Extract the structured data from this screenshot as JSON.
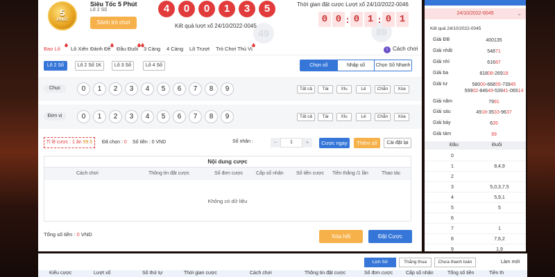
{
  "game": {
    "logo_number": "5",
    "logo_text": "PHÚT",
    "title": "Siêu Tốc 5 Phút",
    "subtitle": "Lô 2 Số",
    "lobby_button": "Sảnh trò chơi",
    "balls": [
      "4",
      "0",
      "0",
      "1",
      "3",
      "5"
    ],
    "result_text": "Kết quả lượt xổ 24/10/2022-0045",
    "countdown_label": "Thời gian đặt cược Lượt xổ 24/10/2022-0046",
    "countdown": [
      "0",
      "0",
      "0",
      "1",
      "0",
      "1"
    ],
    "watermark_balls": [
      "49",
      "89"
    ]
  },
  "tabs": [
    {
      "label": "Bao Lô",
      "active": true,
      "hot": true
    },
    {
      "label": "Lô Xiên",
      "active": false,
      "hot": false
    },
    {
      "label": "Đánh Đề",
      "active": false,
      "hot": true
    },
    {
      "label": "Đầu Đuôi",
      "active": false,
      "hot": true
    },
    {
      "label": "3 Càng",
      "active": false,
      "hot": true
    },
    {
      "label": "4 Càng",
      "active": false,
      "hot": false
    },
    {
      "label": "Lô Trượt",
      "active": false,
      "hot": false
    },
    {
      "label": "Trò Chơi Thú Vị",
      "active": false,
      "hot": true
    }
  ],
  "help_label": "Cách chơi",
  "help_icon": "i",
  "bet_types": [
    {
      "label": "Lô 2 Số",
      "active": true
    },
    {
      "label": "Lô 2 Số 1K",
      "active": false
    },
    {
      "label": "Lô 3 Số",
      "active": false
    },
    {
      "label": "Lô 4 Số",
      "active": false
    }
  ],
  "modes": [
    {
      "label": "Chọn số",
      "active": true
    },
    {
      "label": "Nhập số",
      "active": false
    },
    {
      "label": "Chọn Số Nhanh",
      "active": false
    }
  ],
  "rows": [
    {
      "label": "Chục"
    },
    {
      "label": "Đơn vị"
    }
  ],
  "digits": [
    "0",
    "1",
    "2",
    "3",
    "4",
    "5",
    "6",
    "7",
    "8",
    "9"
  ],
  "quick_select": [
    "Tất cả",
    "Tài",
    "Xỉu",
    "Lẻ",
    "Chẵn",
    "Xóa"
  ],
  "odds": {
    "label": "Tỉ lệ cược : 1 ăn",
    "value": "99.5"
  },
  "selected": {
    "label": "Đã chọn :",
    "value": "0"
  },
  "amount": {
    "label": "Số tiền :",
    "value": "0 VND"
  },
  "multiplier": {
    "label": "Số nhân :",
    "value": "1",
    "minus": "−",
    "plus": "+"
  },
  "buttons": {
    "quick_bet": "Cược ngay",
    "add_number": "Thêm số",
    "reset": "Cài đặt lại",
    "clear_all": "Xóa hết",
    "place_bet": "Đặt Cược"
  },
  "bet_table": {
    "title": "Nội dung cược",
    "headers": [
      "Cách chơi",
      "Thông tin đặt cược",
      "Số đơn cược",
      "Cấp số nhân",
      "Số tiền cược",
      "Tiền thắng /1 lần",
      "Thao tác"
    ],
    "empty": "Không có dữ liệu"
  },
  "total": {
    "label": "Tổng số tiền :",
    "value": "0",
    "unit": "VND"
  },
  "results_panel": {
    "draw_date": "24/10/2022-0045",
    "chevron": "⌄",
    "kq_label": "Kết quả 24/10/2022-0045",
    "prizes": [
      {
        "name": "Giải ĐB",
        "parts": [
          [
            "400135",
            false
          ]
        ]
      },
      {
        "name": "Giải nhất",
        "parts": [
          [
            "548",
            false
          ],
          [
            "71",
            true
          ]
        ]
      },
      {
        "name": "Giải nhì",
        "parts": [
          [
            "616",
            false
          ],
          [
            "87",
            true
          ]
        ]
      },
      {
        "name": "Giải ba",
        "parts": [
          [
            "818",
            false
          ],
          [
            "08",
            true
          ],
          [
            "-269",
            false
          ],
          [
            "18",
            true
          ]
        ]
      },
      {
        "name": "Giải tư",
        "parts": [
          [
            "580",
            false
          ],
          [
            "00",
            true
          ],
          [
            "-668",
            false
          ],
          [
            "55",
            true
          ],
          [
            "-739",
            false
          ],
          [
            "45",
            true
          ]
        ]
      },
      {
        "name": "",
        "parts": [
          [
            "599",
            false
          ],
          [
            "02",
            true
          ],
          [
            "-846",
            false
          ],
          [
            "49",
            true
          ],
          [
            "-539",
            false
          ],
          [
            "41",
            true
          ],
          [
            "-065",
            false
          ],
          [
            "14",
            true
          ]
        ]
      },
      {
        "name": "Giải năm",
        "parts": [
          [
            "79",
            false
          ],
          [
            "91",
            true
          ]
        ]
      },
      {
        "name": "Giải sáu",
        "parts": [
          [
            "49",
            false
          ],
          [
            "18",
            true
          ],
          [
            "-35",
            false
          ],
          [
            "33",
            true
          ],
          [
            "-96",
            false
          ],
          [
            "37",
            true
          ]
        ]
      },
      {
        "name": "Giải bảy",
        "parts": [
          [
            "6",
            false
          ],
          [
            "35",
            true
          ]
        ]
      },
      {
        "name": "Giải tám",
        "parts": [
          [
            "99",
            true
          ]
        ]
      }
    ],
    "head_tail_headers": [
      "Đầu",
      "Đuôi"
    ],
    "head_tail": [
      {
        "head": "0",
        "tail": ""
      },
      {
        "head": "1",
        "tail": "8,4,9"
      },
      {
        "head": "2",
        "tail": ""
      },
      {
        "head": "3",
        "tail": "5,0,3,7,5"
      },
      {
        "head": "4",
        "tail": "5,9,1"
      },
      {
        "head": "5",
        "tail": "5"
      },
      {
        "head": "6",
        "tail": ""
      },
      {
        "head": "7",
        "tail": "1"
      },
      {
        "head": "8",
        "tail": "7,6,2"
      },
      {
        "head": "9",
        "tail": "1,9"
      }
    ]
  },
  "history": {
    "tabs": [
      {
        "label": "Lịch Sử",
        "active": true
      },
      {
        "label": "Thắng thua",
        "active": false
      },
      {
        "label": "Chưa thanh toán",
        "active": false
      }
    ],
    "refresh": "Làm mới",
    "columns": [
      "Kiểu cược",
      "Lượt xổ",
      "Số thứ tự",
      "Thời gian cược",
      "Cách chơi",
      "Thông tin đặt cược",
      "Số đơn cược",
      "Cấp số nhân",
      "Tổng số tiền",
      "Tiền th"
    ]
  },
  "colors": {
    "accent_blue": "#3576d8",
    "accent_red": "#e23b3b",
    "accent_orange": "#f7b14a",
    "background_dark": "#1a0d0a"
  }
}
